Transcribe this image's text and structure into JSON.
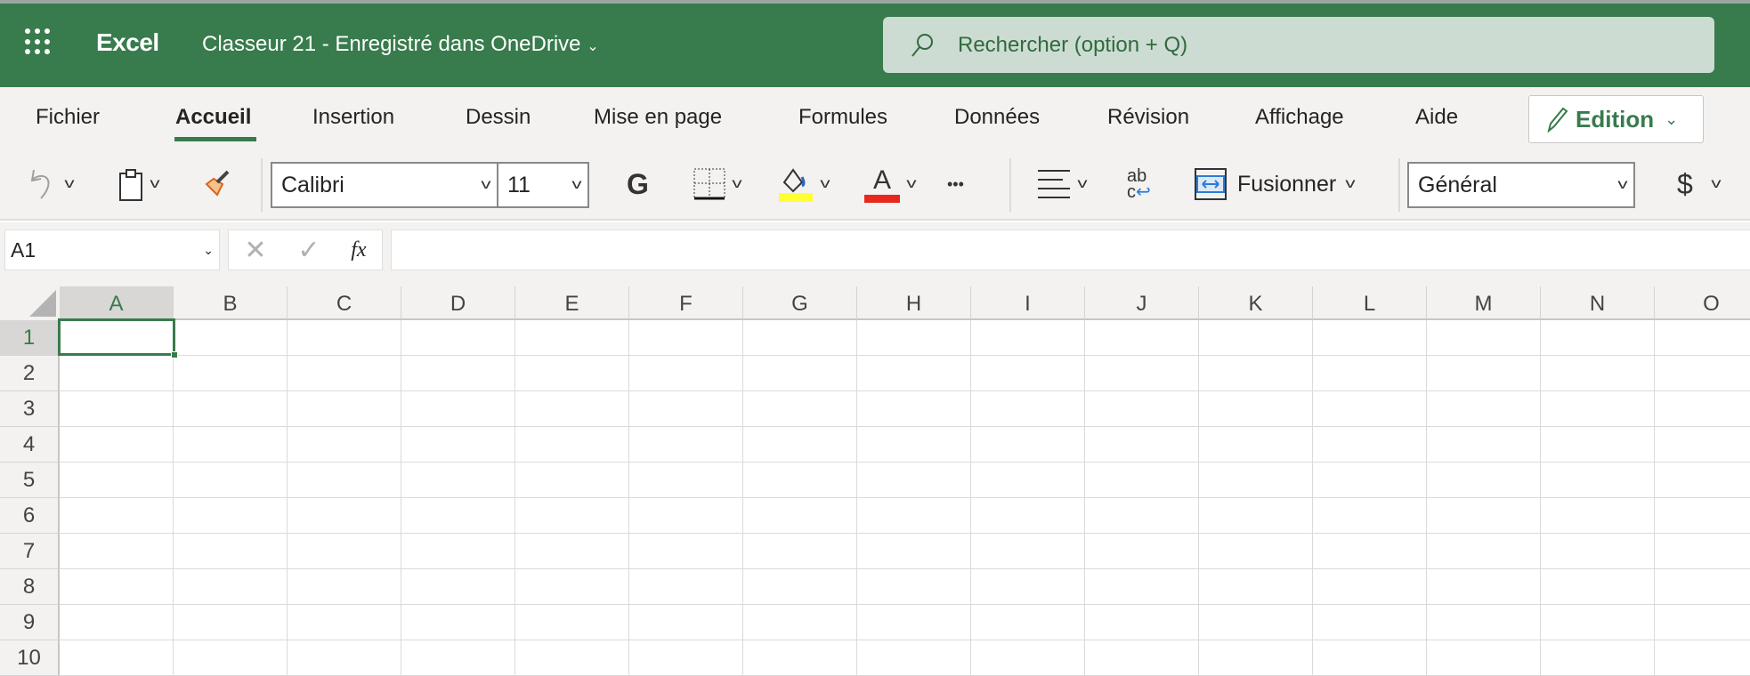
{
  "header": {
    "app_name": "Excel",
    "doc_title": "Classeur 21  -  Enregistré dans OneDrive",
    "search_placeholder": "Rechercher (option + Q)"
  },
  "tabs": [
    {
      "label": "Fichier"
    },
    {
      "label": "Accueil",
      "active": true
    },
    {
      "label": "Insertion"
    },
    {
      "label": "Dessin"
    },
    {
      "label": "Mise en page"
    },
    {
      "label": "Formules"
    },
    {
      "label": "Données"
    },
    {
      "label": "Révision"
    },
    {
      "label": "Affichage"
    },
    {
      "label": "Aide"
    }
  ],
  "mode_button": "Edition",
  "toolbar": {
    "font": "Calibri",
    "size": "11",
    "bold": "G",
    "font_color_letter": "A",
    "more": "•••",
    "wrap_ab": "ab",
    "wrap_c": "c",
    "merge": "Fusionner",
    "number_format": "Général",
    "currency": "$"
  },
  "colors": {
    "brand": "#387b4c",
    "highlight": "#ffff33",
    "font_color": "#e8281c"
  },
  "formula_bar": {
    "name_box": "A1",
    "fx": "fx",
    "value": ""
  },
  "sheet": {
    "columns": [
      "A",
      "B",
      "C",
      "D",
      "E",
      "F",
      "G",
      "H",
      "I",
      "J",
      "K",
      "L",
      "M",
      "N",
      "O"
    ],
    "rows": [
      "1",
      "2",
      "3",
      "4",
      "5",
      "6",
      "7",
      "8",
      "9",
      "10"
    ],
    "selected": "A1"
  }
}
